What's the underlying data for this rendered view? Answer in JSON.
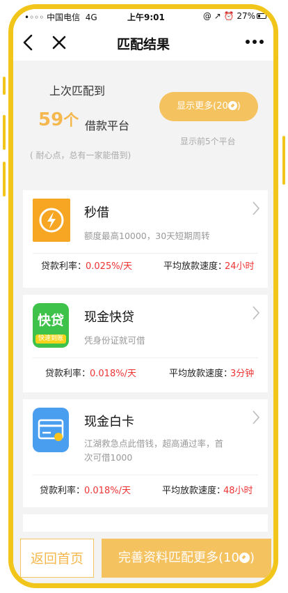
{
  "status_bar": {
    "carrier": "•◦◦◦ 中国电信",
    "network": "4G",
    "time": "上午9:01",
    "indicators": "@ ↗ ⏰ 27%"
  },
  "nav": {
    "title": "匹配结果",
    "back_icon": "chevron-left",
    "close_icon": "close-x",
    "more_icon": "more-dots"
  },
  "summary": {
    "line1": "上次匹配到",
    "count": "59",
    "count_unit": "个",
    "platform_label": "借款平台",
    "hint": "( 耐心点，总有一家能借到)",
    "show_more_label": "显示更多(20",
    "show_more_suffix": ")",
    "show_more_sub": "显示前5个平台"
  },
  "cards": [
    {
      "name": "秒借",
      "desc": "额度最高10000，30天短期周转",
      "rate_label": "贷款利率：",
      "rate_value": "0.025%/天",
      "speed_label": "平均放款速度：",
      "speed_value": "24小时",
      "icon": "lightning-clock",
      "icon_color": "#f6a623"
    },
    {
      "name": "现金快贷",
      "desc": "凭身份证就可借",
      "rate_label": "贷款利率：",
      "rate_value": "0.018%/天",
      "speed_label": "平均放款速度：",
      "speed_value": "3分钟",
      "icon": "kuaidai-logo",
      "icon_text": "快贷",
      "icon_subtext": "快速到账",
      "icon_color": "#3ec24a"
    },
    {
      "name": "现金白卡",
      "desc": "江湖救急点此借钱，超高通过率，首次可借1000",
      "rate_label": "贷款利率：",
      "rate_value": "0.018%/天",
      "speed_label": "平均放款速度：",
      "speed_value": "48小时",
      "icon": "credit-card",
      "icon_color": "#4a9ef0"
    }
  ],
  "bottom": {
    "home_label": "返回首页",
    "complete_label": "完善资料匹配更多(10",
    "complete_suffix": ")"
  },
  "colors": {
    "accent": "#f5c260",
    "frame": "#f2c51b",
    "red": "#e33333"
  }
}
